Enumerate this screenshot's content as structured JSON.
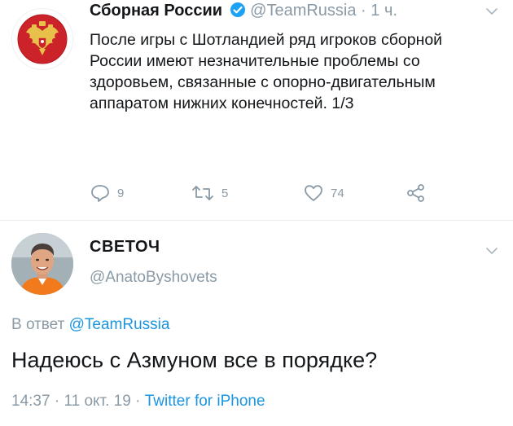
{
  "tweet1": {
    "author_name": "Сборная России",
    "handle": "@TeamRussia",
    "dot": " · ",
    "time": "1 ч.",
    "text": "После игры с Шотландией ряд игроков сборной России имеют незначительные проблемы со здоровьем, связанные с опорно-двигательным аппаратом нижних конечностей. 1/3",
    "replies": "9",
    "retweets": "5",
    "likes": "74"
  },
  "tweet2": {
    "author_name": "СВЕТОЧ",
    "handle": "@AnatoByshovets",
    "reply_prefix": "В ответ ",
    "reply_mention": "@TeamRussia",
    "text": "Надеюсь с Азмуном все в порядке?",
    "time": "14:37",
    "date": "11 окт. 19",
    "sep": " · ",
    "source": "Twitter for iPhone"
  },
  "colors": {
    "link": "#1b95e0",
    "muted": "#8a9aa6",
    "verified": "#1da1f2"
  }
}
